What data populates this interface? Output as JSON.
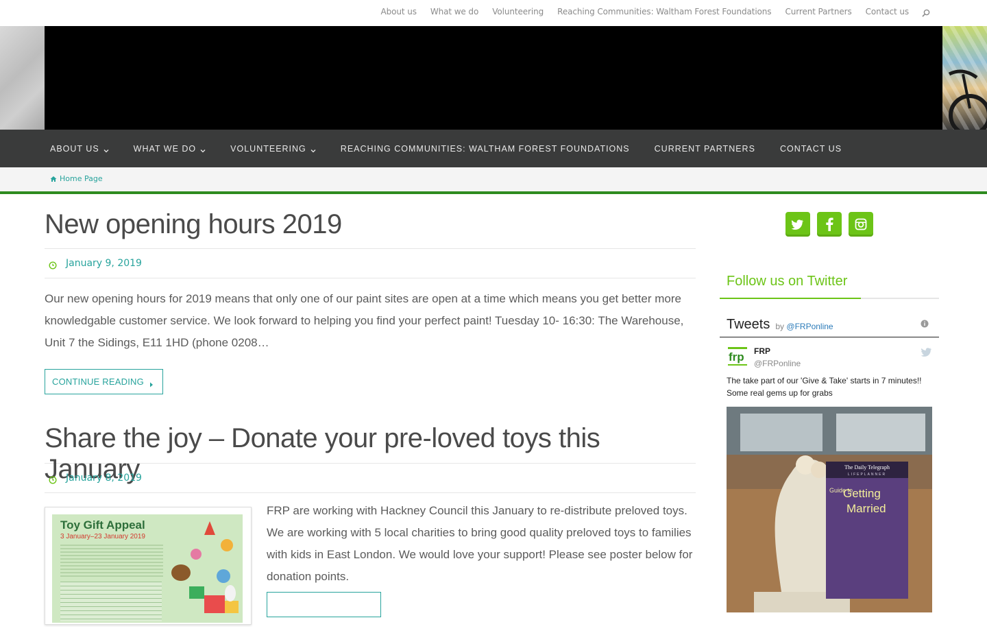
{
  "topnav": {
    "links": [
      "About us",
      "What we do",
      "Volunteering",
      "Reaching Communities: Waltham Forest Foundations",
      "Current Partners",
      "Contact us"
    ]
  },
  "mainnav": {
    "items": [
      {
        "label": "ABOUT US",
        "has_dropdown": true
      },
      {
        "label": "WHAT WE DO",
        "has_dropdown": true
      },
      {
        "label": "VOLUNTEERING",
        "has_dropdown": true
      },
      {
        "label": "REACHING COMMUNITIES: WALTHAM FOREST FOUNDATIONS",
        "has_dropdown": false
      },
      {
        "label": "CURRENT PARTNERS",
        "has_dropdown": false
      },
      {
        "label": "CONTACT US",
        "has_dropdown": false
      }
    ]
  },
  "breadcrumb": {
    "home": "Home Page"
  },
  "posts": [
    {
      "title": "New opening hours 2019",
      "date": "January 9, 2019",
      "excerpt": "Our new opening hours for 2019 means that only one of our paint sites are open at a time which means you get better more knowledgable customer service. We look forward to helping you find your perfect paint! Tuesday 10- 16:30: The Warehouse, Unit 7 the Sidings, E11 1HD (phone 0208…",
      "more_label": "CONTINUE READING"
    },
    {
      "title": "Share the joy – Donate your pre-loved toys this January",
      "date": "January 8, 2019",
      "excerpt": "FRP are working with Hackney Council this January to re-distribute preloved toys. We are working with 5 local charities to bring good quality preloved toys to families with kids in East London. We would love your support! Please see poster below for donation points.",
      "thumb": {
        "heading": "Toy Gift Appeal",
        "dates": "3 January–23 January 2019"
      }
    }
  ],
  "sidebar": {
    "social": [
      "twitter-icon",
      "facebook-icon",
      "instagram-icon"
    ],
    "follow_title": "Follow us on Twitter",
    "tweets_title": "Tweets",
    "tweets_by": "by",
    "tweets_handle": "@FRPonline",
    "tweet": {
      "name": "FRP",
      "handle": "@FRPonline",
      "text": "The take part of our 'Give & Take' starts in 7 minutes!! Some real gems up for grabs",
      "book_publisher": "The Daily Telegraph",
      "book_line": "LIFEPLANNER",
      "book_title_small": "Guide to",
      "book_title": "Getting Married"
    }
  },
  "colors": {
    "accent_teal": "#27a39c",
    "brand_green": "#6cc417",
    "nav_dark": "#3a3b3b",
    "rule_green": "#2e8b1f"
  }
}
